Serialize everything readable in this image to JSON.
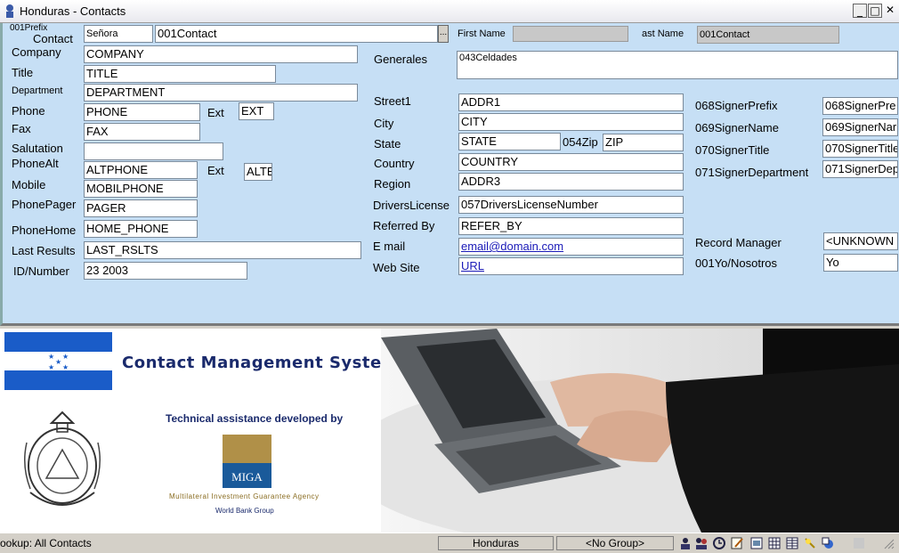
{
  "window": {
    "title": "Honduras - Contacts",
    "minimize": "_",
    "maximize": "□",
    "close": "✕"
  },
  "form": {
    "prefix_label": "001Prefix",
    "prefix_value": "Señora",
    "contact_label": "Contact",
    "contact_value": "001Contact",
    "lookup_btn": "...",
    "firstname_label": "First Name",
    "firstname_value": "",
    "lastname_label": "ast Name",
    "lastname_value": "001Contact",
    "company_label": "Company",
    "company_value": "COMPANY",
    "title_label": "Title",
    "title_value": "TITLE",
    "department_label": "Department",
    "department_value": "DEPARTMENT",
    "phone_label": "Phone",
    "phone_value": "PHONE",
    "ext_label": "Ext",
    "ext_value": "EXT",
    "fax_label": "Fax",
    "fax_value": "FAX",
    "salutation_label": "Salutation",
    "salutation_value": "",
    "phonealt_label": "PhoneAlt",
    "phonealt_value": "ALTPHONE",
    "ext2_label": "Ext",
    "ext2_value": "ALTE",
    "mobile_label": "Mobile",
    "mobile_value": "MOBILPHONE",
    "pager_label": "PhonePager",
    "pager_value": "PAGER",
    "home_label": "PhoneHome",
    "home_value": "HOME_PHONE",
    "lastresults_label": "Last Results",
    "lastresults_value": "LAST_RSLTS",
    "idnumber_label": "ID/Number",
    "idnumber_value": "23 2003",
    "generales_label": "Generales",
    "generales_value": "043Celdades",
    "street_label": "Street1",
    "street_value": "ADDR1",
    "city_label": "City",
    "city_value": "CITY",
    "state_label": "State",
    "state_value": "STATE",
    "zip_label": "054Zip",
    "zip_value": "ZIP",
    "country_label": "Country",
    "country_value": "COUNTRY",
    "region_label": "Region",
    "region_value": "ADDR3",
    "license_label": "DriversLicense",
    "license_value": "057DriversLicenseNumber",
    "referred_label": "Referred By",
    "referred_value": "REFER_BY",
    "email_label": "E mail",
    "email_value": "email@domain.com",
    "website_label": "Web Site",
    "website_value": "URL",
    "signerprefix_label": "068SignerPrefix",
    "signerprefix_value": "068SignerPre",
    "signername_label": "069SignerName",
    "signername_value": "069SignerNar",
    "signertitle_label": "070SignerTitle",
    "signertitle_value": "070SignerTitle",
    "signerdept_label": "071SignerDepartment",
    "signerdept_value": "071SignerDep",
    "recordmgr_label": "Record Manager",
    "recordmgr_value": "<UNKNOWN",
    "yo_label": "001Yo/Nosotros",
    "yo_value": "Yo"
  },
  "banner": {
    "title": "Contact Management System",
    "tech": "Technical assistance developed by",
    "miga_logo": "MIGA",
    "miga_full": "Multilateral Investment Guarantee Agency",
    "world_bank": "World Bank Group"
  },
  "status": {
    "text": "ookup: All Contacts",
    "database": "Honduras",
    "group": "<No Group>"
  },
  "colors": {
    "form_bg": "#c6dff5",
    "banner_title": "#1a2a6c",
    "flag_blue": "#1a5cc8"
  }
}
